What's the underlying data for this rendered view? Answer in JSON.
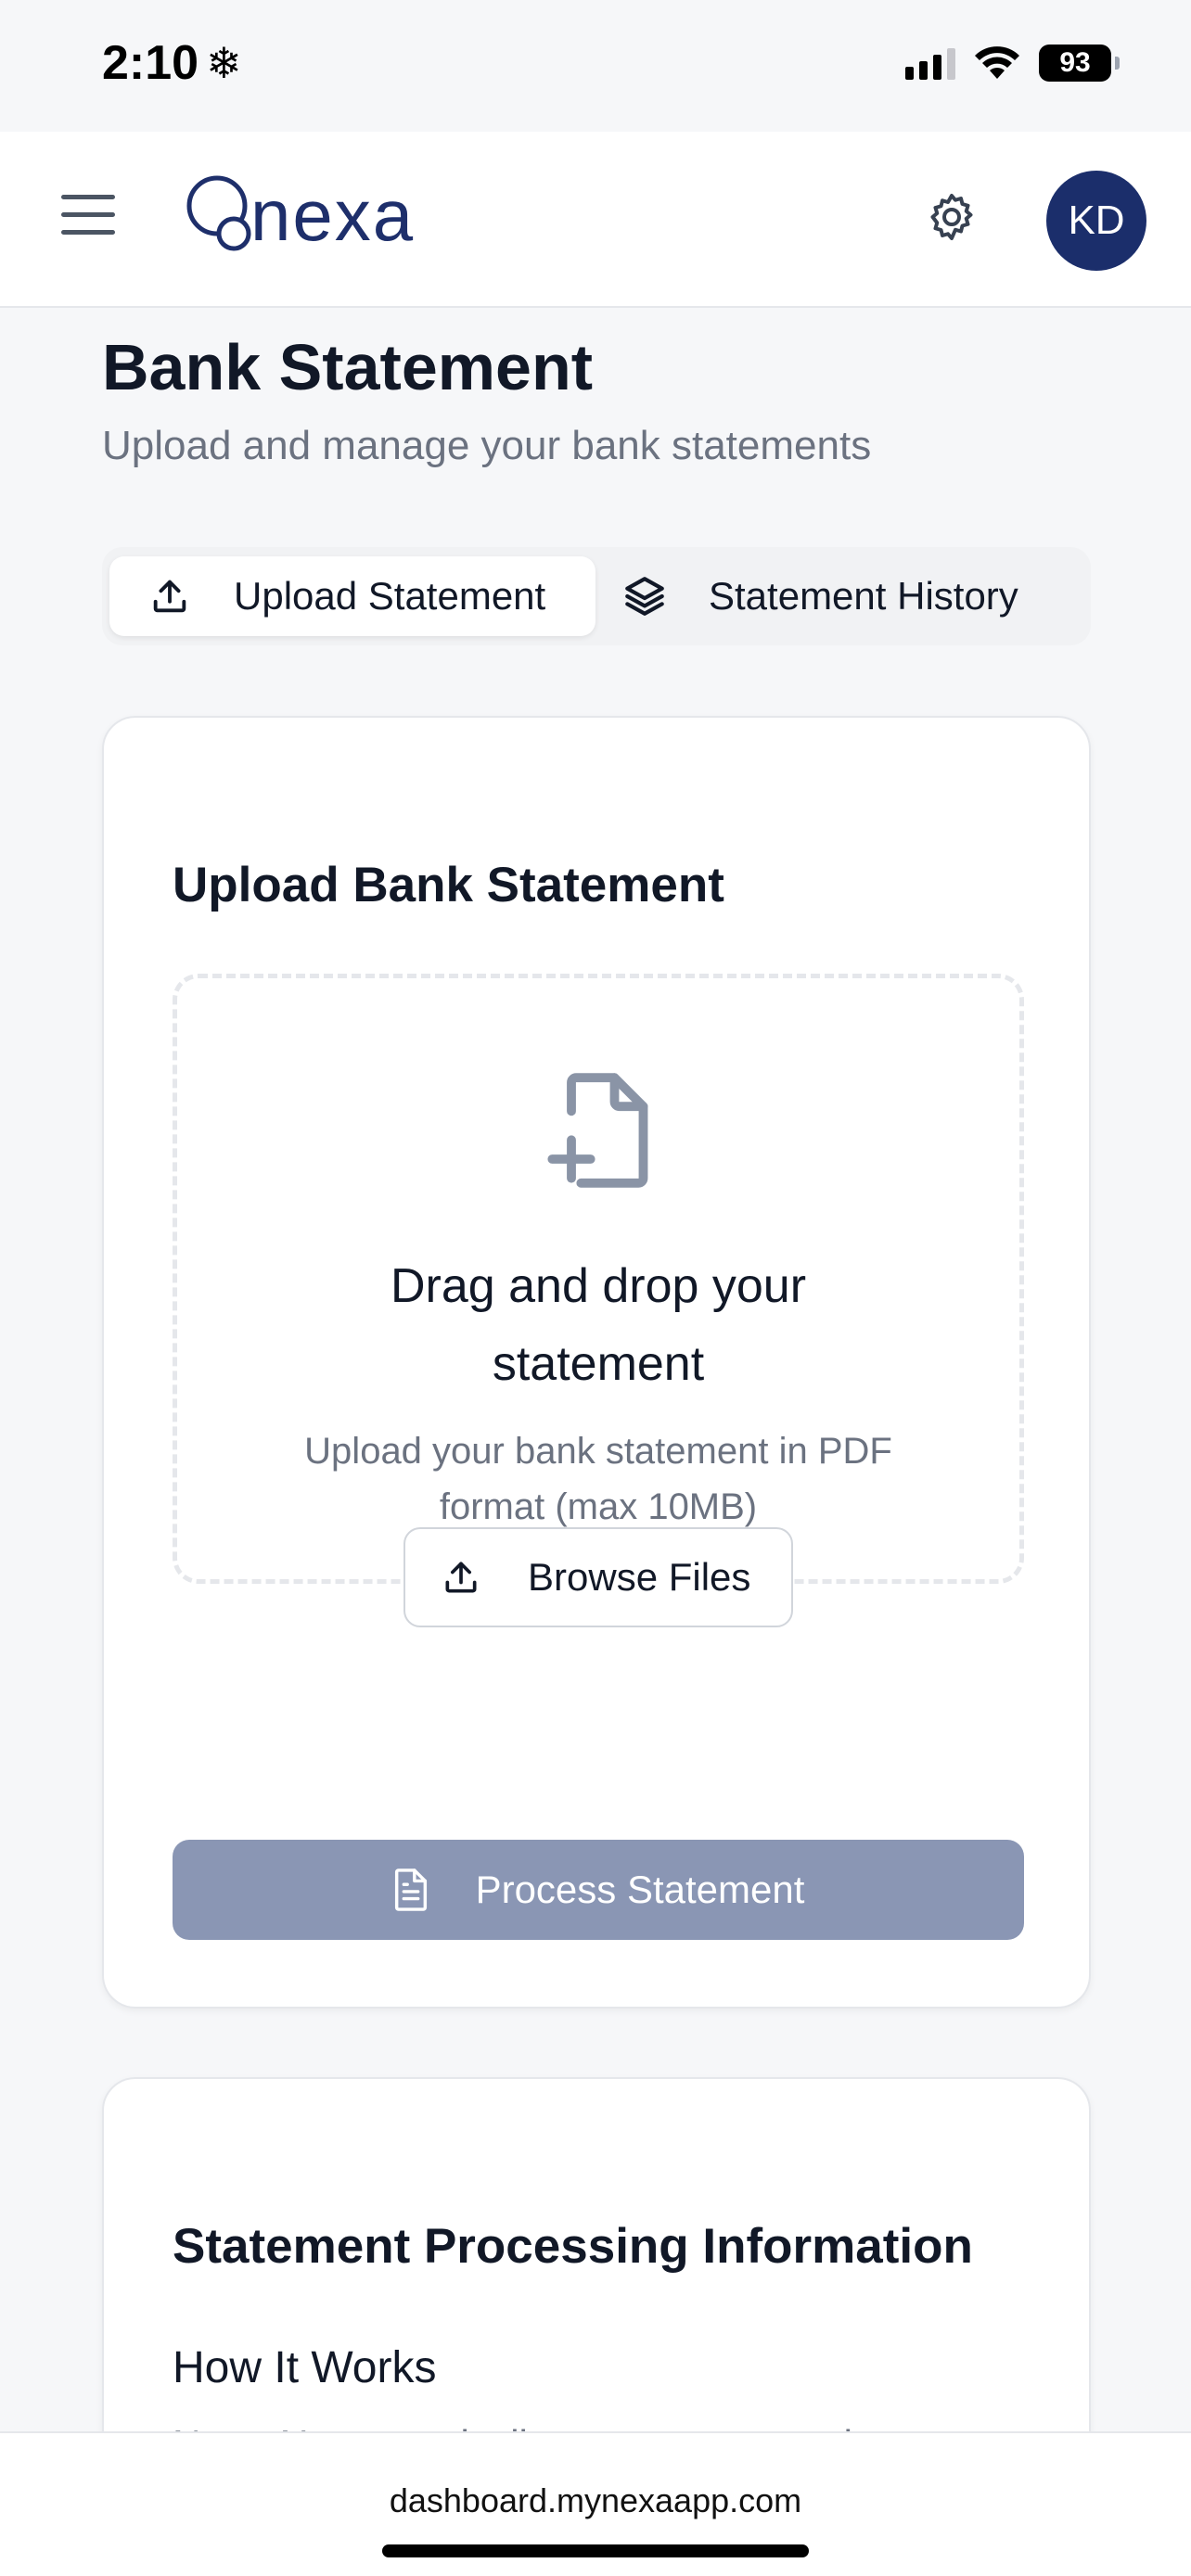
{
  "status_bar": {
    "time": "2:10",
    "weather_glyph": "❄",
    "battery": "93"
  },
  "header": {
    "logo_text": "nexa",
    "avatar_initials": "KD",
    "menu_icon": "hamburger-menu-icon",
    "settings_icon": "gear-icon",
    "brand_color": "#1b2e6b"
  },
  "page": {
    "title": "Bank Statement",
    "subtitle": "Upload and manage your bank statements"
  },
  "tabs": [
    {
      "label": "Upload Statement",
      "icon": "upload-icon",
      "active": true
    },
    {
      "label": "Statement History",
      "icon": "layers-icon",
      "active": false
    }
  ],
  "upload_card": {
    "title": "Upload Bank Statement",
    "drop_title_line1": "Drag and drop your",
    "drop_title_line2": "statement",
    "drop_sub_line1": "Upload your bank statement in PDF",
    "drop_sub_line2": "format (max 10MB)",
    "browse_label": "Browse Files",
    "process_label": "Process Statement",
    "process_color": "#8a96b4"
  },
  "info_card": {
    "title": "Statement Processing Information",
    "subtitle": "How It Works",
    "partial_text": "Nexa AI automatically extracts transactions"
  },
  "browser": {
    "url": "dashboard.mynexaapp.com"
  }
}
